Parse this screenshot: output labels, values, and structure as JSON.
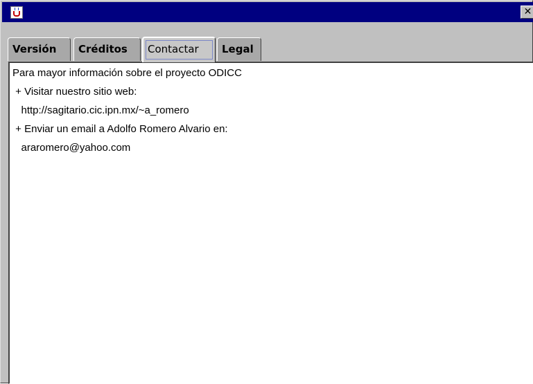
{
  "window": {
    "close_label": "✕"
  },
  "tabs": [
    {
      "label": "Versión",
      "selected": false
    },
    {
      "label": "Créditos",
      "selected": false
    },
    {
      "label": "Contactar",
      "selected": true
    },
    {
      "label": "Legal",
      "selected": false
    }
  ],
  "content": {
    "lines": [
      "Para mayor información sobre el proyecto ODICC",
      " + Visitar nuestro sitio web:",
      "   http://sagitario.cic.ipn.mx/~a_romero",
      " + Enviar un email a Adolfo Romero Alvario en:",
      "   araromero@yahoo.com"
    ]
  }
}
